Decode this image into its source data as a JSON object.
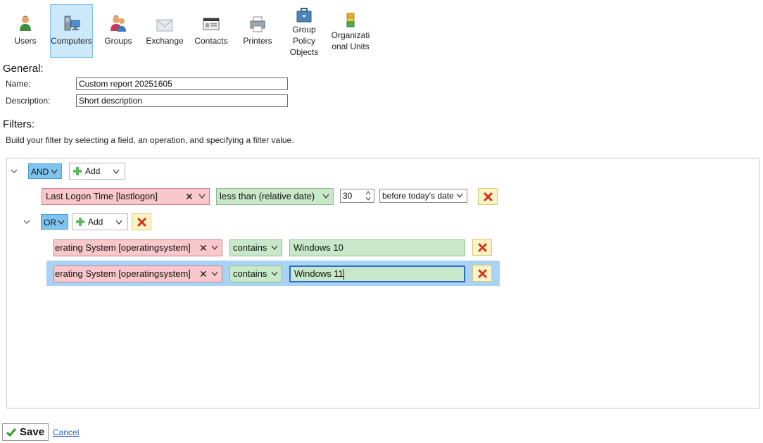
{
  "toolbar": {
    "items": [
      {
        "label": "Users",
        "icon": "user-icon"
      },
      {
        "label": "Computers",
        "icon": "computer-icon",
        "active": true
      },
      {
        "label": "Groups",
        "icon": "group-icon"
      },
      {
        "label": "Exchange",
        "icon": "mail-icon"
      },
      {
        "label": "Contacts",
        "icon": "contact-card-icon"
      },
      {
        "label": "Printers",
        "icon": "printer-icon"
      },
      {
        "label": "Group Policy Objects",
        "icon": "briefcase-icon"
      },
      {
        "label": "Organizational Units",
        "icon": "ou-icon"
      }
    ],
    "group_policy_lines": [
      "Group",
      "Policy",
      "Objects"
    ],
    "ou_lines": [
      "Organizati",
      "onal Units"
    ]
  },
  "general": {
    "title": "General:",
    "name_label": "Name:",
    "name_value": "Custom report 20251605",
    "description_label": "Description:",
    "description_value": "Short description"
  },
  "filters": {
    "title": "Filters:",
    "help": "Build your filter by selecting a field, an operation, and specifying a filter value.",
    "root": {
      "operator": "AND",
      "add_label": "Add",
      "conditions": [
        {
          "field": "Last Logon Time [lastlogon]",
          "operation": "less than (relative date)",
          "value": "30",
          "unit": "before today's date"
        }
      ],
      "group": {
        "operator": "OR",
        "add_label": "Add",
        "conditions": [
          {
            "field": "erating System [operatingsystem]",
            "operation": "contains",
            "value": "Windows 10"
          },
          {
            "field": "erating System [operatingsystem]",
            "operation": "contains",
            "value": "Windows 11",
            "selected": true
          }
        ]
      }
    }
  },
  "actions": {
    "save_label": "Save",
    "cancel_label": "Cancel"
  },
  "colors": {
    "accent": "#cce8fb",
    "operator_blue": "#7fc4ef",
    "field_pink": "#f9c8cc",
    "op_green": "#c9e8c9",
    "delete_red": "#d7301f",
    "selected_row": "#a9d3f5"
  }
}
